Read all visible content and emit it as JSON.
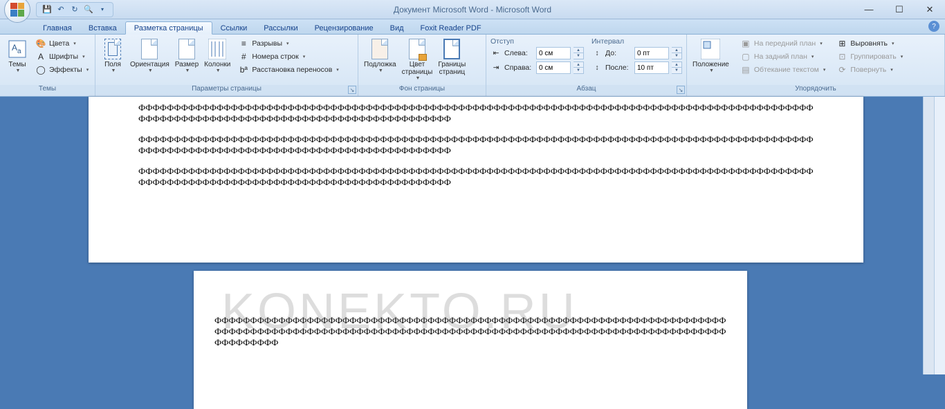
{
  "title": "Документ Microsoft Word - Microsoft Word",
  "tabs": {
    "home": "Главная",
    "insert": "Вставка",
    "page_layout": "Разметка страницы",
    "references": "Ссылки",
    "mailings": "Рассылки",
    "review": "Рецензирование",
    "view": "Вид",
    "foxit": "Foxit Reader PDF"
  },
  "groups": {
    "themes": "Темы",
    "page_setup": "Параметры страницы",
    "page_background": "Фон страницы",
    "paragraph": "Абзац",
    "arrange": "Упорядочить"
  },
  "themes_group": {
    "themes": "Темы",
    "colors": "Цвета",
    "fonts": "Шрифты",
    "effects": "Эффекты"
  },
  "page_setup": {
    "margins": "Поля",
    "orientation": "Ориентация",
    "size": "Размер",
    "columns": "Колонки",
    "breaks": "Разрывы",
    "line_numbers": "Номера строк",
    "hyphenation": "Расстановка переносов"
  },
  "page_bg": {
    "watermark": "Подложка",
    "page_color": "Цвет\nстраницы",
    "page_borders": "Границы\nстраниц"
  },
  "paragraph": {
    "indent_label": "Отступ",
    "left_label": "Слева:",
    "right_label": "Справа:",
    "left_val": "0 см",
    "right_val": "0 см",
    "spacing_label": "Интервал",
    "before_label": "До:",
    "after_label": "После:",
    "before_val": "0 пт",
    "after_val": "10 пт"
  },
  "arrange": {
    "position": "Положение",
    "bring_front": "На передний план",
    "send_back": "На задний план",
    "text_wrap": "Обтекание текстом",
    "align": "Выровнять",
    "group": "Группировать",
    "rotate": "Повернуть"
  },
  "document": {
    "long_line": "ФФФФФФФФФФФФФФФФФФФФФФФФФФФФФФФФФФФФФФФФФФФФФФФФФФФФФФФФФФФФФФФФФФФФФФФФФФФФФФФФФФФФФФФФФФФФФФФФФФФФФФФФФФФФФФФФФФФФФФФФФФФФФ",
    "short_line": "ФФФФФФФФФФФФФФФФФФФФФФФФФФФФФФФФФФФФФФФФФФФФ",
    "p2_line1": "ФФФФФФФФФФФФФФФФФФФФФФФФФФФФФФФФФФФФФФФФФФФФФФФФФФФФФФФФФФФФФФФФФФФФФФФФФФФФФФФФФФФФФФФФФФФФ ФФ",
    "p2_line2": "ФФФФФФФФФФФФФФФФФФФФФФФФФФФФФФФФФФФФФФФФФФФФФФФФФФФФФФФФФФФФФФФФФФФФФФФФФФФФФФФФФФФФФФФФФФФФФФФ",
    "p2_line3": "ФФФФФФФФФ"
  },
  "watermark": "KONEKTO.RU"
}
